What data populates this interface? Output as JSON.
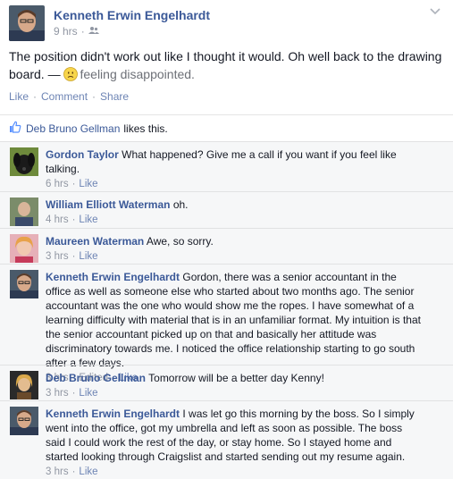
{
  "post": {
    "author": "Kenneth Erwin Engelhardt",
    "time": "9 hrs",
    "status_text": "The position didn't work out like I thought it would. Oh well back to the drawing board. — ",
    "feeling": "feeling disappointed.",
    "actions": {
      "like": "Like",
      "comment": "Comment",
      "share": "Share",
      "separator": "·"
    }
  },
  "likes": {
    "name": "Deb Bruno Gellman",
    "suffix": "likes this."
  },
  "comments": [
    {
      "author": "Gordon Taylor",
      "text": "What happened? Give me a call if you want if you feel like talking.",
      "time": "6 hrs",
      "like": "Like",
      "edited": ""
    },
    {
      "author": "William Elliott Waterman",
      "text": "oh.",
      "time": "4 hrs",
      "like": "Like",
      "edited": ""
    },
    {
      "author": "Maureen Waterman",
      "text": "Awe, so sorry.",
      "time": "3 hrs",
      "like": "Like",
      "edited": ""
    },
    {
      "author": "Kenneth Erwin Engelhardt",
      "text": "Gordon, there was a senior accountant in the office as well as someone else who started about two months ago. The senior accountant was the one who would show me the ropes. I have somewhat of a learning difficulty with material that is in an unfamiliar format. My intuition is that the senior accountant picked up on that and basically her attitude was discriminatory towards me. I noticed the office relationship starting to go south after a few days.",
      "time": "3 hrs",
      "like": "Like",
      "edited": "Edited"
    },
    {
      "author": "Deb Bruno Gellman",
      "text": "Tomorrow will be a better day Kenny!",
      "time": "3 hrs",
      "like": "Like",
      "edited": ""
    },
    {
      "author": "Kenneth Erwin Engelhardt",
      "text": "I was let go this morning by the boss. So I simply went into the office, got my umbrella and left as soon as possible. The boss said I could work the rest of the day, or stay home. So I stayed home and started looking through Craigslist and started sending out my resume again.",
      "time": "3 hrs",
      "like": "Like",
      "edited": ""
    }
  ],
  "colors": {
    "link": "#3b5998",
    "meta": "#9197a3",
    "action": "#6d84b4",
    "comments_bg": "#f6f7f8"
  }
}
